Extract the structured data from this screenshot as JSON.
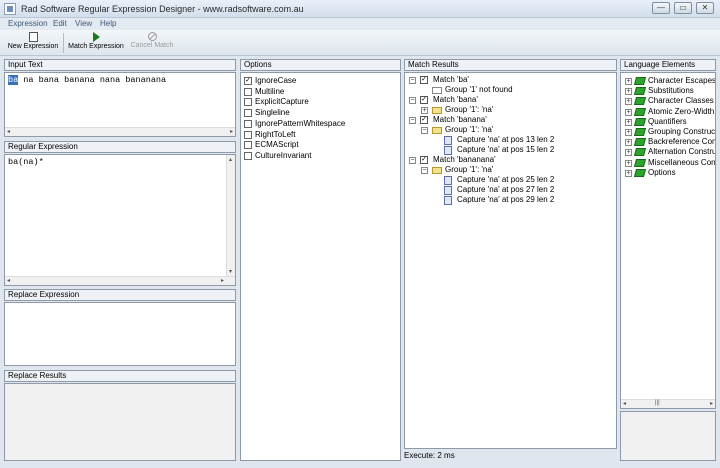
{
  "window": {
    "title": "Rad Software Regular Expression Designer - www.radsoftware.com.au",
    "buttons": {
      "minimize": "—",
      "maximize": "▭",
      "close": "✕"
    }
  },
  "menu": [
    "Expression",
    "Edit",
    "View",
    "Help"
  ],
  "toolbar": {
    "new_label": "New Expression",
    "match_label": "Match Expression",
    "cancel_label": "Cancel Match"
  },
  "input_text": {
    "header": "Input Text",
    "highlight": "ba",
    "value": " na bana banana nana bananana"
  },
  "regex": {
    "header": "Regular Expression",
    "value": "ba(na)*"
  },
  "replace_expression": {
    "header": "Replace Expression",
    "value": ""
  },
  "replace_results": {
    "header": "Replace Results",
    "value": ""
  },
  "options": {
    "header": "Options",
    "items": [
      {
        "label": "IgnoreCase",
        "checked": true
      },
      {
        "label": "Multiline",
        "checked": false
      },
      {
        "label": "ExplicitCapture",
        "checked": false
      },
      {
        "label": "Singleline",
        "checked": false
      },
      {
        "label": "IgnorePatternWhitespace",
        "checked": false
      },
      {
        "label": "RightToLeft",
        "checked": false
      },
      {
        "label": "ECMAScript",
        "checked": false
      },
      {
        "label": "CultureInvariant",
        "checked": false
      }
    ]
  },
  "match_results": {
    "header": "Match Results",
    "rows": [
      {
        "text": "Match 'ba'",
        "kind": "match"
      },
      {
        "text": "Group '1' not found",
        "kind": "group-empty"
      },
      {
        "text": "Match 'bana'",
        "kind": "match"
      },
      {
        "text": "Group '1': 'na'",
        "kind": "group-collapsed"
      },
      {
        "text": "Match 'banana'",
        "kind": "match"
      },
      {
        "text": "Group '1': 'na'",
        "kind": "group"
      },
      {
        "text": "Capture 'na' at pos 13 len 2",
        "kind": "capture"
      },
      {
        "text": "Capture 'na' at pos 15 len 2",
        "kind": "capture"
      },
      {
        "text": "Match 'bananana'",
        "kind": "match"
      },
      {
        "text": "Group '1': 'na'",
        "kind": "group"
      },
      {
        "text": "Capture 'na' at pos 25 len 2",
        "kind": "capture"
      },
      {
        "text": "Capture 'na' at pos 27 len 2",
        "kind": "capture"
      },
      {
        "text": "Capture 'na' at pos 29 len 2",
        "kind": "capture"
      }
    ]
  },
  "language_elements": {
    "header": "Language Elements",
    "items": [
      "Character Escapes",
      "Substitutions",
      "Character Classes",
      "Atomic Zero-Width",
      "Quantifiers",
      "Grouping Construct",
      "Backreference Cons",
      "Alternation Constru",
      "Miscellaneous Cons",
      "Options"
    ]
  },
  "status": {
    "execute": "Execute: 2 ms"
  },
  "glyphs": {
    "plus": "+",
    "minus": "−",
    "check": "✓",
    "left": "◂",
    "right": "▸",
    "up": "▴",
    "down": "▾",
    "grip": "|||"
  },
  "colors": {
    "selection": "#3b6fb6",
    "book_icon": "#2fa12f",
    "folder_icon": "#f2e18d",
    "play_icon": "#1b7a1b"
  }
}
